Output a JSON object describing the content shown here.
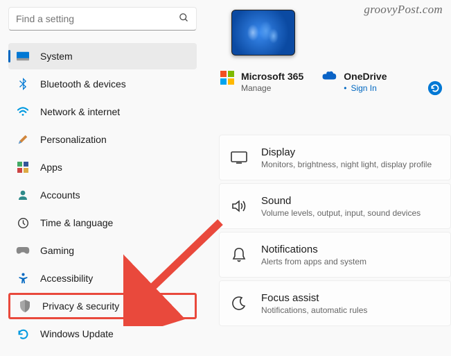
{
  "watermark": "groovyPost.com",
  "search": {
    "placeholder": "Find a setting"
  },
  "sidebar": {
    "items": [
      {
        "label": "System",
        "icon": "monitor",
        "active": true
      },
      {
        "label": "Bluetooth & devices",
        "icon": "bluetooth"
      },
      {
        "label": "Network & internet",
        "icon": "wifi"
      },
      {
        "label": "Personalization",
        "icon": "brush"
      },
      {
        "label": "Apps",
        "icon": "apps"
      },
      {
        "label": "Accounts",
        "icon": "person"
      },
      {
        "label": "Time & language",
        "icon": "clock"
      },
      {
        "label": "Gaming",
        "icon": "gamepad"
      },
      {
        "label": "Accessibility",
        "icon": "accessibility"
      },
      {
        "label": "Privacy & security",
        "icon": "shield",
        "highlighted": true
      },
      {
        "label": "Windows Update",
        "icon": "update"
      }
    ]
  },
  "accounts": {
    "ms365": {
      "title": "Microsoft 365",
      "sub": "Manage"
    },
    "onedrive": {
      "title": "OneDrive",
      "sub": "Sign In"
    }
  },
  "settings_cards": [
    {
      "title": "Display",
      "desc": "Monitors, brightness, night light, display profile",
      "icon": "display"
    },
    {
      "title": "Sound",
      "desc": "Volume levels, output, input, sound devices",
      "icon": "sound"
    },
    {
      "title": "Notifications",
      "desc": "Alerts from apps and system",
      "icon": "bell"
    },
    {
      "title": "Focus assist",
      "desc": "Notifications, automatic rules",
      "icon": "moon"
    }
  ]
}
